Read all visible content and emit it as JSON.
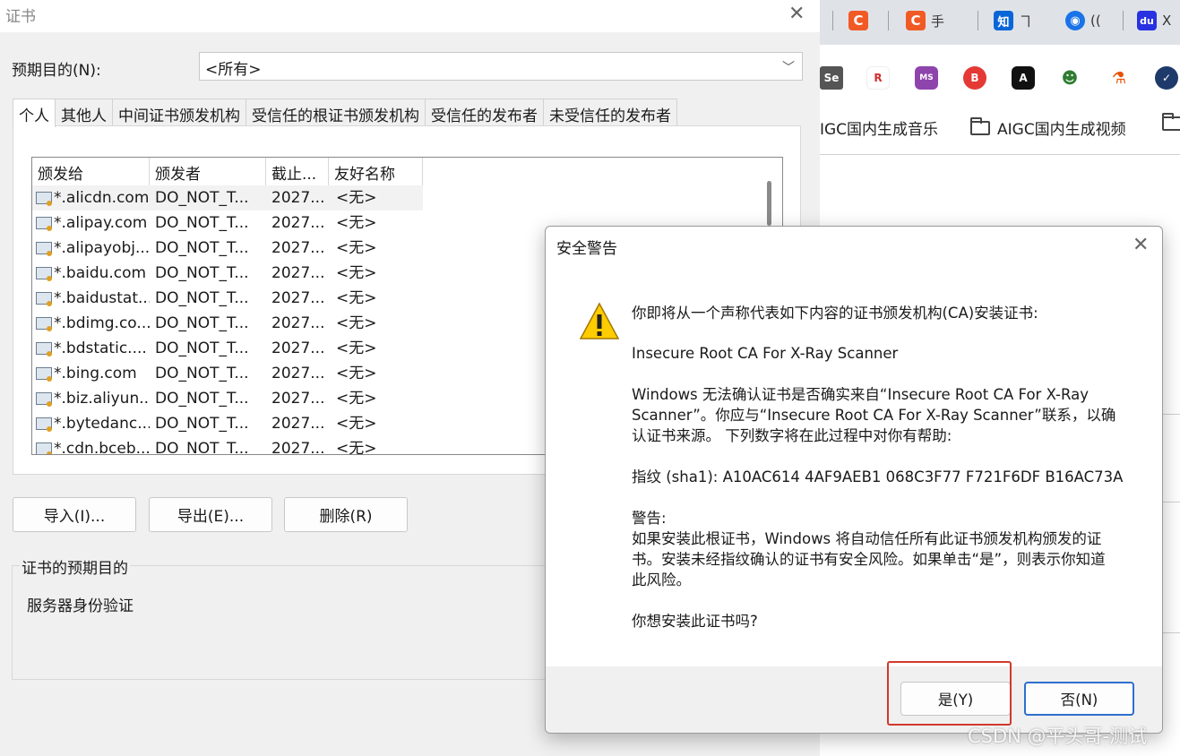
{
  "cert_window": {
    "title": "证书",
    "purpose_label": "预期目的(N):",
    "purpose_value": "<所有>",
    "tabs": [
      "个人",
      "其他人",
      "中间证书颁发机构",
      "受信任的根证书颁发机构",
      "受信任的发布者",
      "未受信任的发布者"
    ],
    "columns": [
      "颁发给",
      "颁发者",
      "截止...",
      "友好名称"
    ],
    "rows": [
      {
        "issued_to": "*.alicdn.com",
        "issuer": "DO_NOT_T...",
        "expires": "2027...",
        "friendly": "<无>"
      },
      {
        "issued_to": "*.alipay.com",
        "issuer": "DO_NOT_T...",
        "expires": "2027...",
        "friendly": "<无>"
      },
      {
        "issued_to": "*.alipayobj...",
        "issuer": "DO_NOT_T...",
        "expires": "2027...",
        "friendly": "<无>"
      },
      {
        "issued_to": "*.baidu.com",
        "issuer": "DO_NOT_T...",
        "expires": "2027...",
        "friendly": "<无>"
      },
      {
        "issued_to": "*.baidustat...",
        "issuer": "DO_NOT_T...",
        "expires": "2027...",
        "friendly": "<无>"
      },
      {
        "issued_to": "*.bdimg.co...",
        "issuer": "DO_NOT_T...",
        "expires": "2027...",
        "friendly": "<无>"
      },
      {
        "issued_to": "*.bdstatic....",
        "issuer": "DO_NOT_T...",
        "expires": "2027...",
        "friendly": "<无>"
      },
      {
        "issued_to": "*.bing.com",
        "issuer": "DO_NOT_T...",
        "expires": "2027...",
        "friendly": "<无>"
      },
      {
        "issued_to": "*.biz.aliyun...",
        "issuer": "DO_NOT_T...",
        "expires": "2027...",
        "friendly": "<无>"
      },
      {
        "issued_to": "*.bytedanc...",
        "issuer": "DO_NOT_T...",
        "expires": "2027...",
        "friendly": "<无>"
      },
      {
        "issued_to": "*.cdn.bceb...",
        "issuer": "DO_NOT_T...",
        "expires": "2027...",
        "friendly": "<无>"
      }
    ],
    "buttons": {
      "import": "导入(I)...",
      "export": "导出(E)...",
      "remove": "删除(R)"
    },
    "group_label": "证书的预期目的",
    "group_text": "服务器身份验证"
  },
  "security_warning": {
    "title": "安全警告",
    "line1": "你即将从一个声称代表如下内容的证书颁发机构(CA)安装证书:",
    "ca_name": "Insecure Root CA For X-Ray Scanner",
    "para1_l1": "Windows 无法确认证书是否确实来自“Insecure Root CA For X-Ray",
    "para1_l2": "Scanner”。你应与“Insecure Root CA For X-Ray Scanner”联系，以确",
    "para1_l3": "认证书来源。 下列数字将在此过程中对你有帮助:",
    "thumbprint": "指纹 (sha1): A10AC614 4AF9AEB1 068C3F77 F721F6DF B16AC73A",
    "warning_label": "警告:",
    "warn_l1": "如果安装此根证书，Windows 将自动信任所有此证书颁发机构颁发的证",
    "warn_l2": "书。安装未经指纹确认的证书有安全风险。如果单击“是”，则表示你知道",
    "warn_l3": "此风险。",
    "question": "你想安装此证书吗?",
    "yes_label": "是(Y)",
    "no_label": "否(N)"
  },
  "browser": {
    "tabs": [
      {
        "icon_text": "C",
        "color": "#f15a24",
        "label": ""
      },
      {
        "icon_text": "C",
        "color": "#f15a24",
        "label": "手"
      },
      {
        "icon_text": "知",
        "color": "#0a66d8",
        "label": "ヿ"
      },
      {
        "icon_text": "◉",
        "color": "#1a73e8",
        "label": "(("
      },
      {
        "icon_text": "du",
        "color": "#2932e1",
        "label": "X"
      }
    ],
    "bookmark_icons": [
      "Se",
      "R",
      "MS",
      "B",
      "A",
      "☻",
      "⚗",
      "✓"
    ],
    "folders": [
      "IGC国内生成音乐",
      "AIGC国内生成视频"
    ]
  },
  "watermark": "CSDN @平头哥-测试"
}
